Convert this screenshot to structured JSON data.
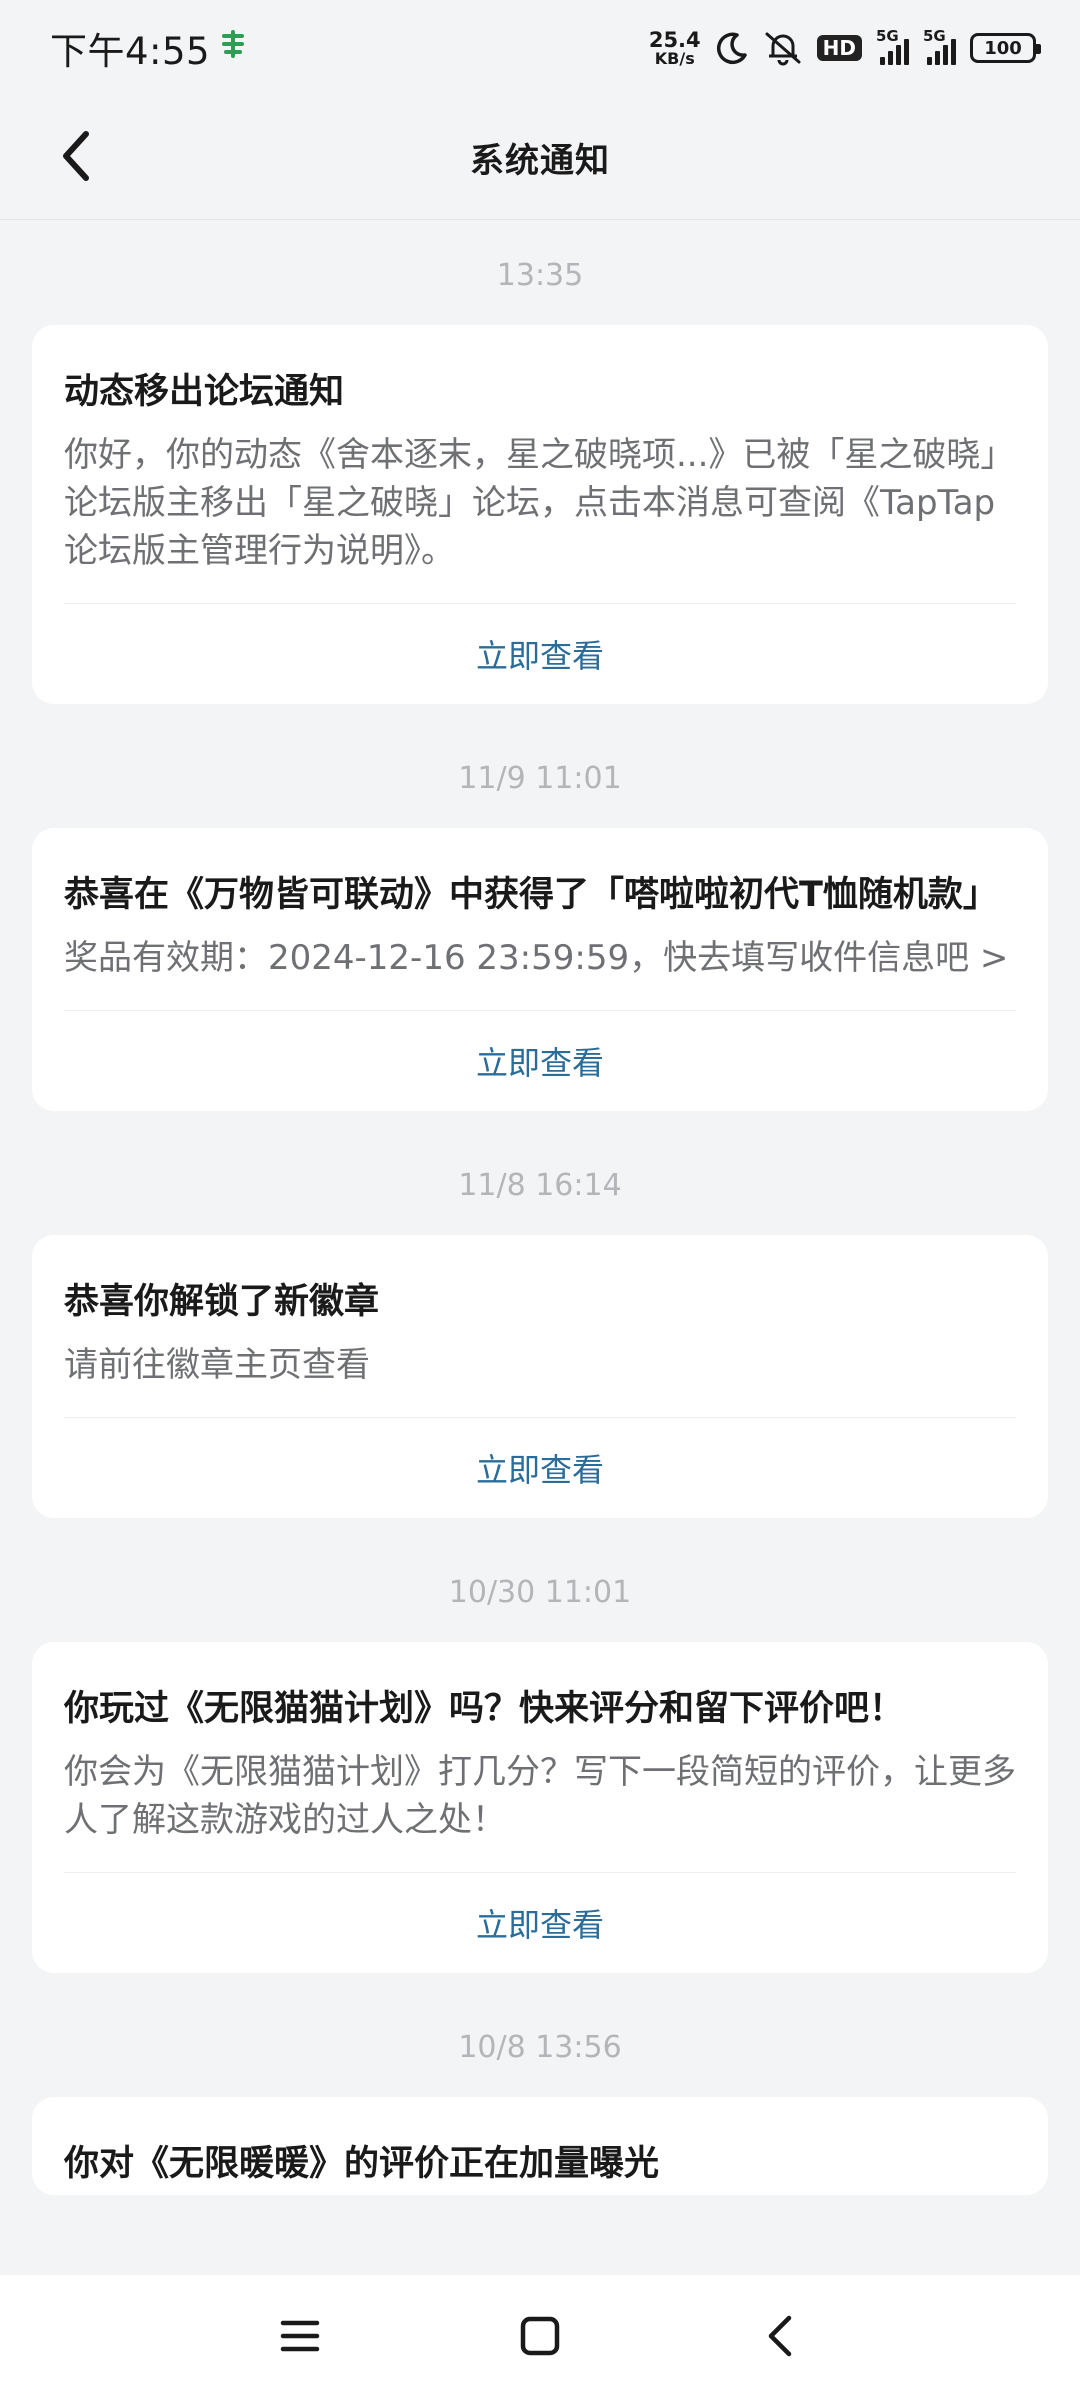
{
  "status_bar": {
    "time": "下午4:55",
    "app_icon": "payment-app-icon",
    "net_speed_value": "25.4",
    "net_speed_unit": "KB/s",
    "hd_label": "HD",
    "signal_1_label": "5G",
    "signal_2_label": "5G",
    "battery": "100"
  },
  "header": {
    "title": "系统通知",
    "back_icon": "chevron-left-icon"
  },
  "notifications": [
    {
      "time": "13:35",
      "title": "动态移出论坛通知",
      "body": "你好，你的动态《舍本逐末，星之破晓项...》已被「星之破晓」论坛版主移出「星之破晓」论坛，点击本消息可查阅《TapTap论坛版主管理行为说明》。",
      "action": "立即查看"
    },
    {
      "time": "11/9  11:01",
      "title": "恭喜在《万物皆可联动》中获得了「嗒啦啦初代T恤随机款」",
      "body": "奖品有效期：2024-12-16 23:59:59，快去填写收件信息吧 >",
      "action": "立即查看"
    },
    {
      "time": "11/8  16:14",
      "title": "恭喜你解锁了新徽章",
      "body": "请前往徽章主页查看",
      "action": "立即查看"
    },
    {
      "time": "10/30  11:01",
      "title": "你玩过《无限猫猫计划》吗？快来评分和留下评价吧！",
      "body": "你会为《无限猫猫计划》打几分？写下一段简短的评价，让更多人了解这款游戏的过人之处！",
      "action": "立即查看"
    },
    {
      "time": "10/8  13:56",
      "title": "你对《无限暖暖》的评价正在加量曝光",
      "body": "",
      "action": ""
    }
  ],
  "nav_bar": {
    "menu_icon": "menu-icon",
    "home_icon": "home-square-icon",
    "back_icon": "back-triangle-icon"
  },
  "colors": {
    "background": "#f3f4f6",
    "card": "#ffffff",
    "action_link": "#2a6d9a",
    "time_label": "#b3b5b8",
    "body_text": "#6e7074"
  }
}
